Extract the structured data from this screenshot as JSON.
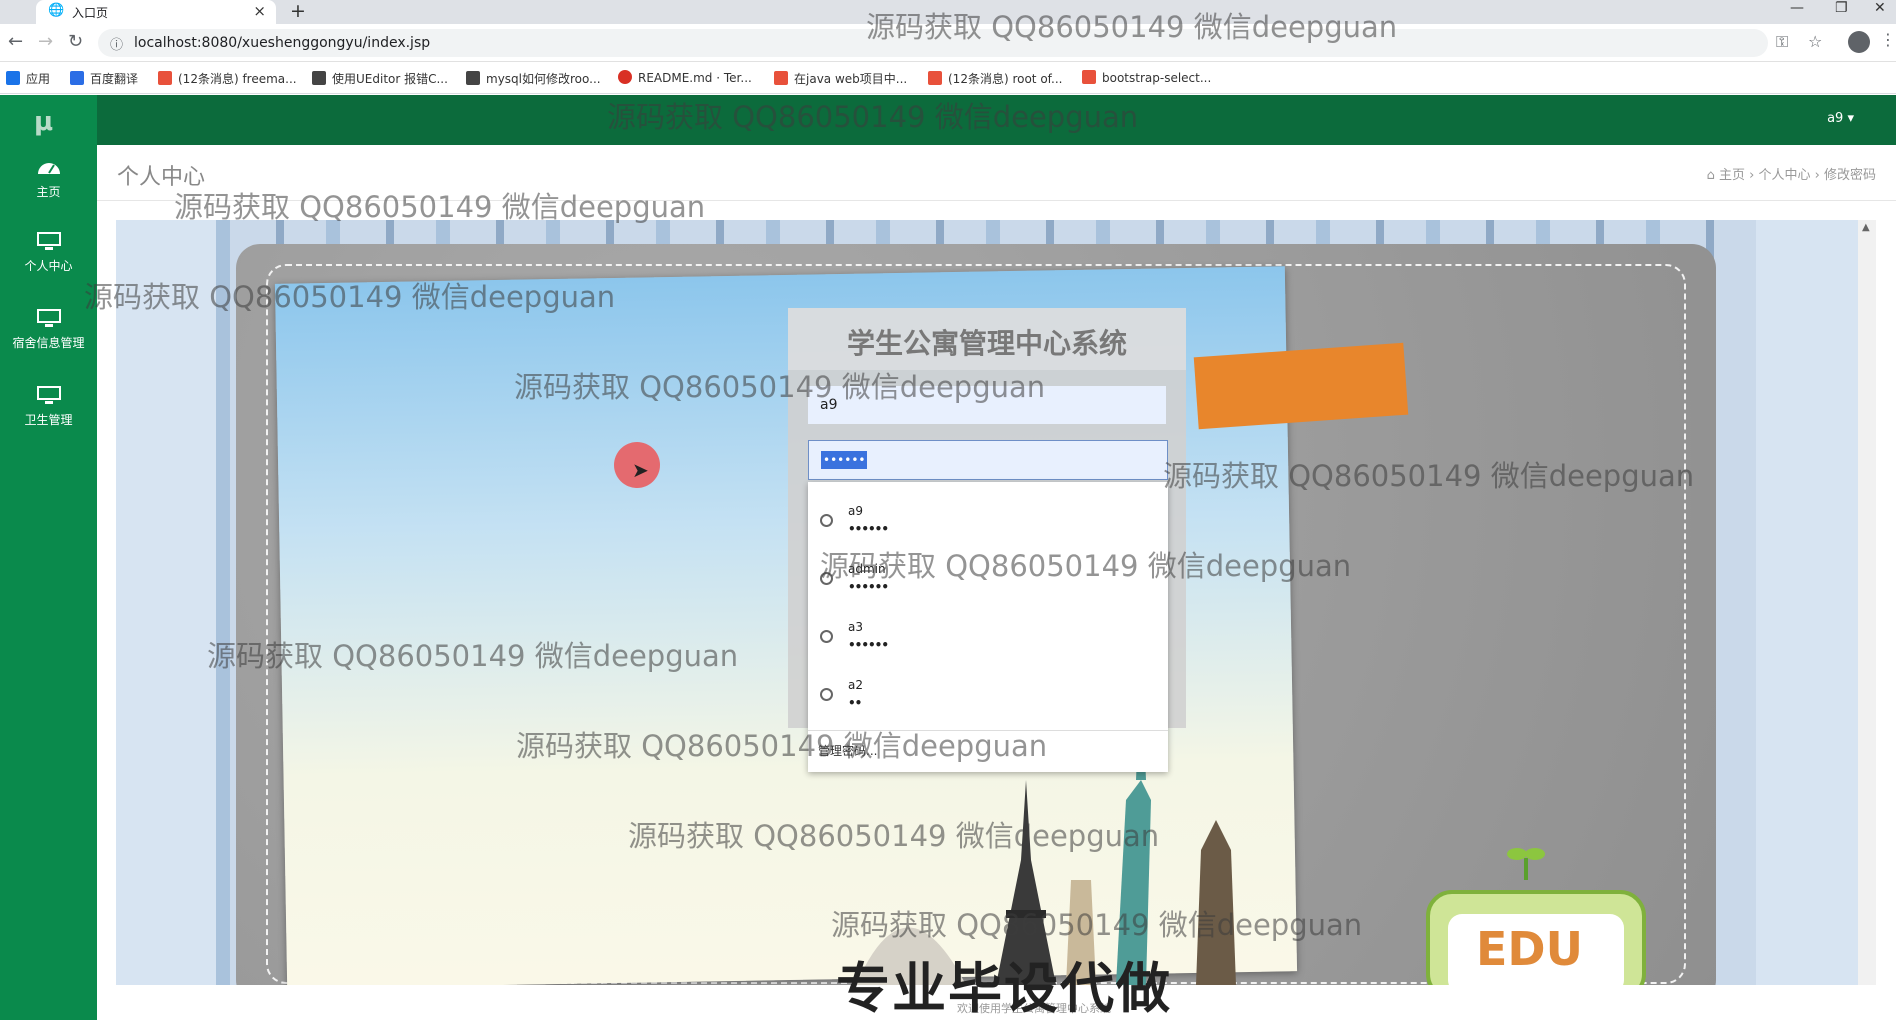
{
  "browser": {
    "tab_title": "入口页",
    "url": "localhost:8080/xueshenggongyu/index.jsp",
    "bookmarks": [
      {
        "label": "应用",
        "color": "#1a73e8"
      },
      {
        "label": "百度翻译",
        "color": "#2b6de5"
      },
      {
        "label": "(12条消息) freema...",
        "color": "#e8513b"
      },
      {
        "label": "使用UEditor 报错C...",
        "color": "#444444"
      },
      {
        "label": "mysql如何修改roo...",
        "color": "#444444"
      },
      {
        "label": "README.md · Ter...",
        "color": "#d93025"
      },
      {
        "label": "在java web项目中...",
        "color": "#e8513b"
      },
      {
        "label": "(12条消息) root of...",
        "color": "#e8513b"
      },
      {
        "label": "bootstrap-select...",
        "color": "#e8513b"
      }
    ]
  },
  "app": {
    "logo": "μ",
    "user_menu": "a9 ▾",
    "sidebar": [
      {
        "label": "主页",
        "icon": "dashboard-icon"
      },
      {
        "label": "个人中心",
        "icon": "monitor-icon"
      },
      {
        "label": "宿舍信息管理",
        "icon": "monitor-icon"
      },
      {
        "label": "卫生管理",
        "icon": "monitor-icon"
      }
    ],
    "page_title": "个人中心",
    "breadcrumb": [
      "主页",
      "个人中心",
      "修改密码"
    ]
  },
  "login": {
    "title": "学生公寓管理中心系统",
    "username": "a9",
    "password_mask": "••••••"
  },
  "autocomplete": {
    "items": [
      {
        "user": "a9",
        "mask": "••••••"
      },
      {
        "user": "admin",
        "mask": "••••••"
      },
      {
        "user": "a3",
        "mask": "••••••"
      },
      {
        "user": "a2",
        "mask": "••"
      }
    ],
    "manage": "管理密码..."
  },
  "overlay": {
    "watermark": "源码获取 QQ86050149 微信deepguan",
    "slogan": "专业毕设代做",
    "footer": "欢迎使用学生公寓管理中心系统"
  },
  "colors": {
    "sidebar": "#0a8a4c",
    "topnav": "#0c6b3c",
    "accent_orange": "#e8862c"
  }
}
